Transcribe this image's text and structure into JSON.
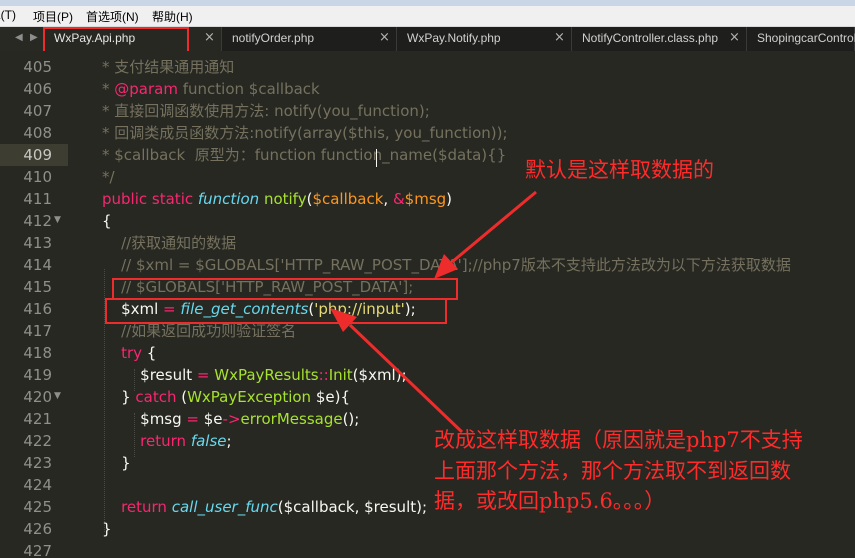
{
  "menu": [
    {
      "name": "menu-tools",
      "label": "L(T)"
    },
    {
      "name": "menu-project",
      "label": "项目(P)"
    },
    {
      "name": "menu-preferences",
      "label": "首选项(N)"
    },
    {
      "name": "menu-help",
      "label": "帮助(H)"
    }
  ],
  "tabs": [
    {
      "label": "WxPay.Api.php",
      "active": true
    },
    {
      "label": "notifyOrder.php",
      "active": false
    },
    {
      "label": "WxPay.Notify.php",
      "active": false
    },
    {
      "label": "NotifyController.class.php",
      "active": false
    },
    {
      "label": "ShopingcarControll",
      "active": false
    }
  ],
  "icons": {
    "nav_left": "nav-left-arrow-icon",
    "nav_right": "nav-right-arrow-icon",
    "close": "close-icon",
    "fold": "fold-arrow-icon"
  },
  "colors": {
    "background": "#272822",
    "comment": "#75715e",
    "keyword": "#f92672",
    "storage": "#66d9ef",
    "function": "#a6e22e",
    "variable": "#fd971f",
    "string": "#e6db74",
    "annotation": "#ff2b2b"
  },
  "editor": {
    "current_line": "409",
    "lines": [
      {
        "num": "405",
        "fold": false,
        "tokens": [
          {
            "t": "c",
            "v": "* 支付结果通用通知"
          }
        ]
      },
      {
        "num": "406",
        "fold": false,
        "tokens": [
          {
            "t": "c",
            "v": "* "
          },
          {
            "t": "kw",
            "v": "@param"
          },
          {
            "t": "c",
            "v": " function $callback"
          }
        ]
      },
      {
        "num": "407",
        "fold": false,
        "tokens": [
          {
            "t": "c",
            "v": "* 直接回调函数使用方法: notify(you_function);"
          }
        ]
      },
      {
        "num": "408",
        "fold": false,
        "tokens": [
          {
            "t": "c",
            "v": "* 回调类成员函数方法:notify(array($this, you_function));"
          }
        ]
      },
      {
        "num": "409",
        "fold": false,
        "tokens": [
          {
            "t": "c",
            "v": "* $callback  原型为：function function_name($data){}"
          }
        ]
      },
      {
        "num": "410",
        "fold": false,
        "tokens": [
          {
            "t": "c",
            "v": "*/"
          }
        ]
      },
      {
        "num": "411",
        "fold": false,
        "tokens": [
          {
            "t": "kw",
            "v": "public"
          },
          {
            "t": "pl",
            "v": " "
          },
          {
            "t": "kw",
            "v": "static"
          },
          {
            "t": "pl",
            "v": " "
          },
          {
            "t": "st",
            "v": "function"
          },
          {
            "t": "pl",
            "v": " "
          },
          {
            "t": "fn",
            "v": "notify"
          },
          {
            "t": "pl",
            "v": "("
          },
          {
            "t": "vr",
            "v": "$callback"
          },
          {
            "t": "pl",
            "v": ", "
          },
          {
            "t": "kw",
            "v": "&"
          },
          {
            "t": "vr",
            "v": "$msg"
          },
          {
            "t": "pl",
            "v": ")"
          }
        ]
      },
      {
        "num": "412",
        "fold": true,
        "tokens": [
          {
            "t": "pl",
            "v": "{"
          }
        ]
      },
      {
        "num": "413",
        "fold": false,
        "tokens": [
          {
            "t": "pl",
            "v": "    "
          },
          {
            "t": "c",
            "v": "//获取通知的数据"
          }
        ]
      },
      {
        "num": "414",
        "fold": false,
        "tokens": [
          {
            "t": "pl",
            "v": "    "
          },
          {
            "t": "c",
            "v": "// $xml = $GLOBALS['HTTP_RAW_POST_DATA'];//php7版本不支持此方法改为以下方法获取数据"
          }
        ]
      },
      {
        "num": "415",
        "fold": false,
        "tokens": [
          {
            "t": "pl",
            "v": "    "
          },
          {
            "t": "c",
            "v": "// $GLOBALS['HTTP_RAW_POST_DATA'];"
          }
        ]
      },
      {
        "num": "416",
        "fold": false,
        "tokens": [
          {
            "t": "pl",
            "v": "    $xml "
          },
          {
            "t": "kw",
            "v": "="
          },
          {
            "t": "pl",
            "v": " "
          },
          {
            "t": "st",
            "v": "file_get_contents"
          },
          {
            "t": "pl",
            "v": "("
          },
          {
            "t": "str",
            "v": "'php://input'"
          },
          {
            "t": "pl",
            "v": ");"
          }
        ]
      },
      {
        "num": "417",
        "fold": false,
        "tokens": [
          {
            "t": "pl",
            "v": "    "
          },
          {
            "t": "c",
            "v": "//如果返回成功则验证签名"
          }
        ]
      },
      {
        "num": "418",
        "fold": false,
        "tokens": [
          {
            "t": "pl",
            "v": "    "
          },
          {
            "t": "kw",
            "v": "try"
          },
          {
            "t": "pl",
            "v": " {"
          }
        ]
      },
      {
        "num": "419",
        "fold": false,
        "tokens": [
          {
            "t": "pl",
            "v": "        $result "
          },
          {
            "t": "kw",
            "v": "="
          },
          {
            "t": "pl",
            "v": " "
          },
          {
            "t": "fn",
            "v": "WxPayResults"
          },
          {
            "t": "kw",
            "v": "::"
          },
          {
            "t": "fn",
            "v": "Init"
          },
          {
            "t": "pl",
            "v": "($xml);"
          }
        ]
      },
      {
        "num": "420",
        "fold": true,
        "tokens": [
          {
            "t": "pl",
            "v": "    } "
          },
          {
            "t": "kw",
            "v": "catch"
          },
          {
            "t": "pl",
            "v": " ("
          },
          {
            "t": "fn",
            "v": "WxPayException"
          },
          {
            "t": "pl",
            "v": " $e){"
          }
        ]
      },
      {
        "num": "421",
        "fold": false,
        "tokens": [
          {
            "t": "pl",
            "v": "        $msg "
          },
          {
            "t": "kw",
            "v": "="
          },
          {
            "t": "pl",
            "v": " $e"
          },
          {
            "t": "kw",
            "v": "->"
          },
          {
            "t": "fn",
            "v": "errorMessage"
          },
          {
            "t": "pl",
            "v": "();"
          }
        ]
      },
      {
        "num": "422",
        "fold": false,
        "tokens": [
          {
            "t": "pl",
            "v": "        "
          },
          {
            "t": "kw",
            "v": "return"
          },
          {
            "t": "pl",
            "v": " "
          },
          {
            "t": "st",
            "v": "false"
          },
          {
            "t": "pl",
            "v": ";"
          }
        ]
      },
      {
        "num": "423",
        "fold": false,
        "tokens": [
          {
            "t": "pl",
            "v": "    }"
          }
        ]
      },
      {
        "num": "424",
        "fold": false,
        "tokens": []
      },
      {
        "num": "425",
        "fold": false,
        "tokens": [
          {
            "t": "pl",
            "v": "    "
          },
          {
            "t": "kw",
            "v": "return"
          },
          {
            "t": "pl",
            "v": " "
          },
          {
            "t": "st",
            "v": "call_user_func"
          },
          {
            "t": "pl",
            "v": "($callback, $result);"
          }
        ]
      },
      {
        "num": "426",
        "fold": false,
        "tokens": [
          {
            "t": "pl",
            "v": "}"
          }
        ]
      },
      {
        "num": "427",
        "fold": false,
        "tokens": []
      }
    ]
  },
  "annotations": {
    "top": "默认是这样取数据的",
    "bottom": [
      "改成这样取数据（原因就是php7不支持",
      "上面那个方法，那个方法取不到返回数",
      "据，或改回php5.6。。。）"
    ]
  }
}
